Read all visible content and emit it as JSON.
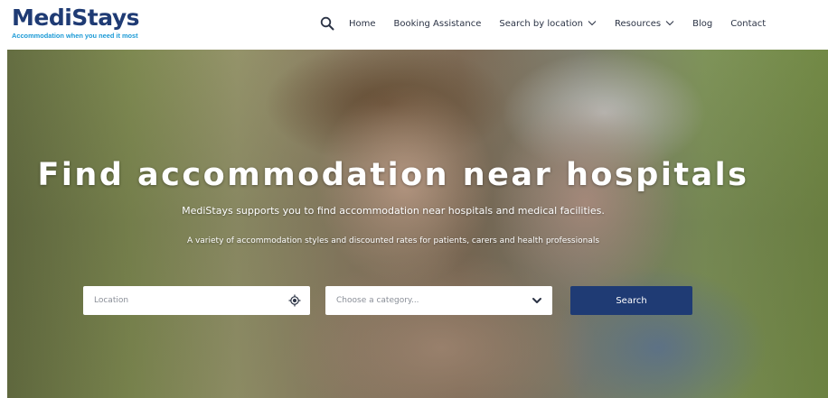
{
  "brand": {
    "name": "MediStays",
    "tagline": "Accommodation when you need it most",
    "primary_color": "#1f3b74",
    "accent_color": "#1b9ad6"
  },
  "nav": {
    "search_icon": "search-icon",
    "items": [
      {
        "label": "Home",
        "dropdown": false
      },
      {
        "label": "Booking Assistance",
        "dropdown": false
      },
      {
        "label": "Search by location",
        "dropdown": true
      },
      {
        "label": "Resources",
        "dropdown": true
      },
      {
        "label": "Blog",
        "dropdown": false
      },
      {
        "label": "Contact",
        "dropdown": false
      }
    ]
  },
  "hero": {
    "title": "Find accommodation near hospitals",
    "subtitle": "MediStays supports you to find accommodation near hospitals and medical facilities.",
    "description": "A variety of accommodation styles and discounted rates for patients, carers and health professionals"
  },
  "search_form": {
    "location_placeholder": "Location",
    "location_icon": "locate-icon",
    "category_placeholder": "Choose a category...",
    "category_icon": "chevron-down-icon",
    "submit_label": "Search"
  }
}
